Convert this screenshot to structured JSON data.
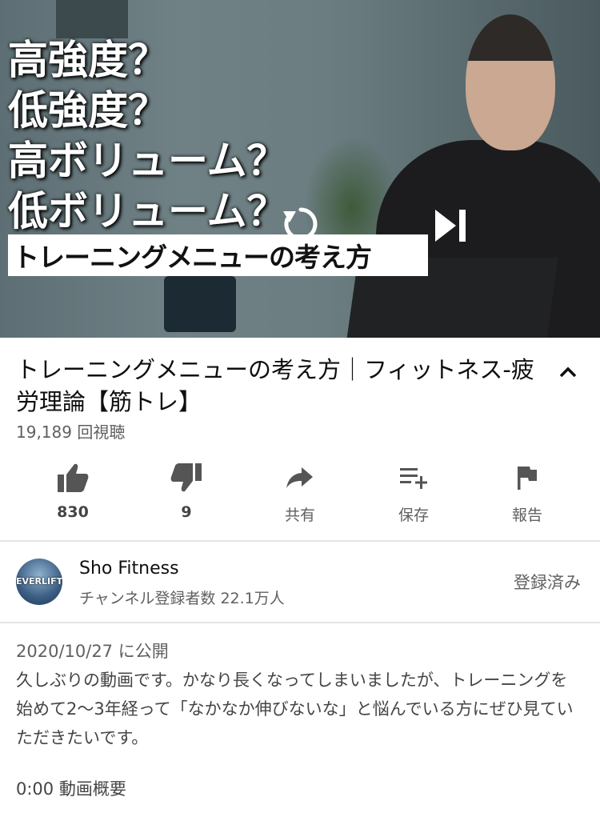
{
  "video": {
    "thumbnail_lines": [
      "高強度？",
      "低強度？",
      "高ボリューム？",
      "低ボリューム？"
    ],
    "thumbnail_banner": "トレーニングメニューの考え方",
    "replay_icon": "replay-icon",
    "next_icon": "skip-next-icon"
  },
  "title": "トレーニングメニューの考え方｜フィットネス-疲労理論【筋トレ】",
  "views": "19,189 回視聴",
  "actions": {
    "like": {
      "label": "830",
      "icon": "thumb-up-icon"
    },
    "dislike": {
      "label": "9",
      "icon": "thumb-down-icon"
    },
    "share": {
      "label": "共有",
      "icon": "share-icon"
    },
    "save": {
      "label": "保存",
      "icon": "playlist-add-icon"
    },
    "report": {
      "label": "報告",
      "icon": "flag-icon"
    }
  },
  "channel": {
    "name": "Sho Fitness",
    "subscribers": "チャンネル登録者数 22.1万人",
    "avatar_text": "EVERLIFT",
    "subscribe_status": "登録済み"
  },
  "description": {
    "date": "2020/10/27 に公開",
    "body": "久しぶりの動画です。かなり長くなってしまいましたが、トレーニングを始めて2〜3年経って「なかなか伸びないな」と悩んでいる方にぜひ見ていただきたいです。",
    "chapter": "0:00 動画概要"
  },
  "colors": {
    "text": "#0f0f0f",
    "secondary": "#606060",
    "divider": "#e5e5e5"
  }
}
